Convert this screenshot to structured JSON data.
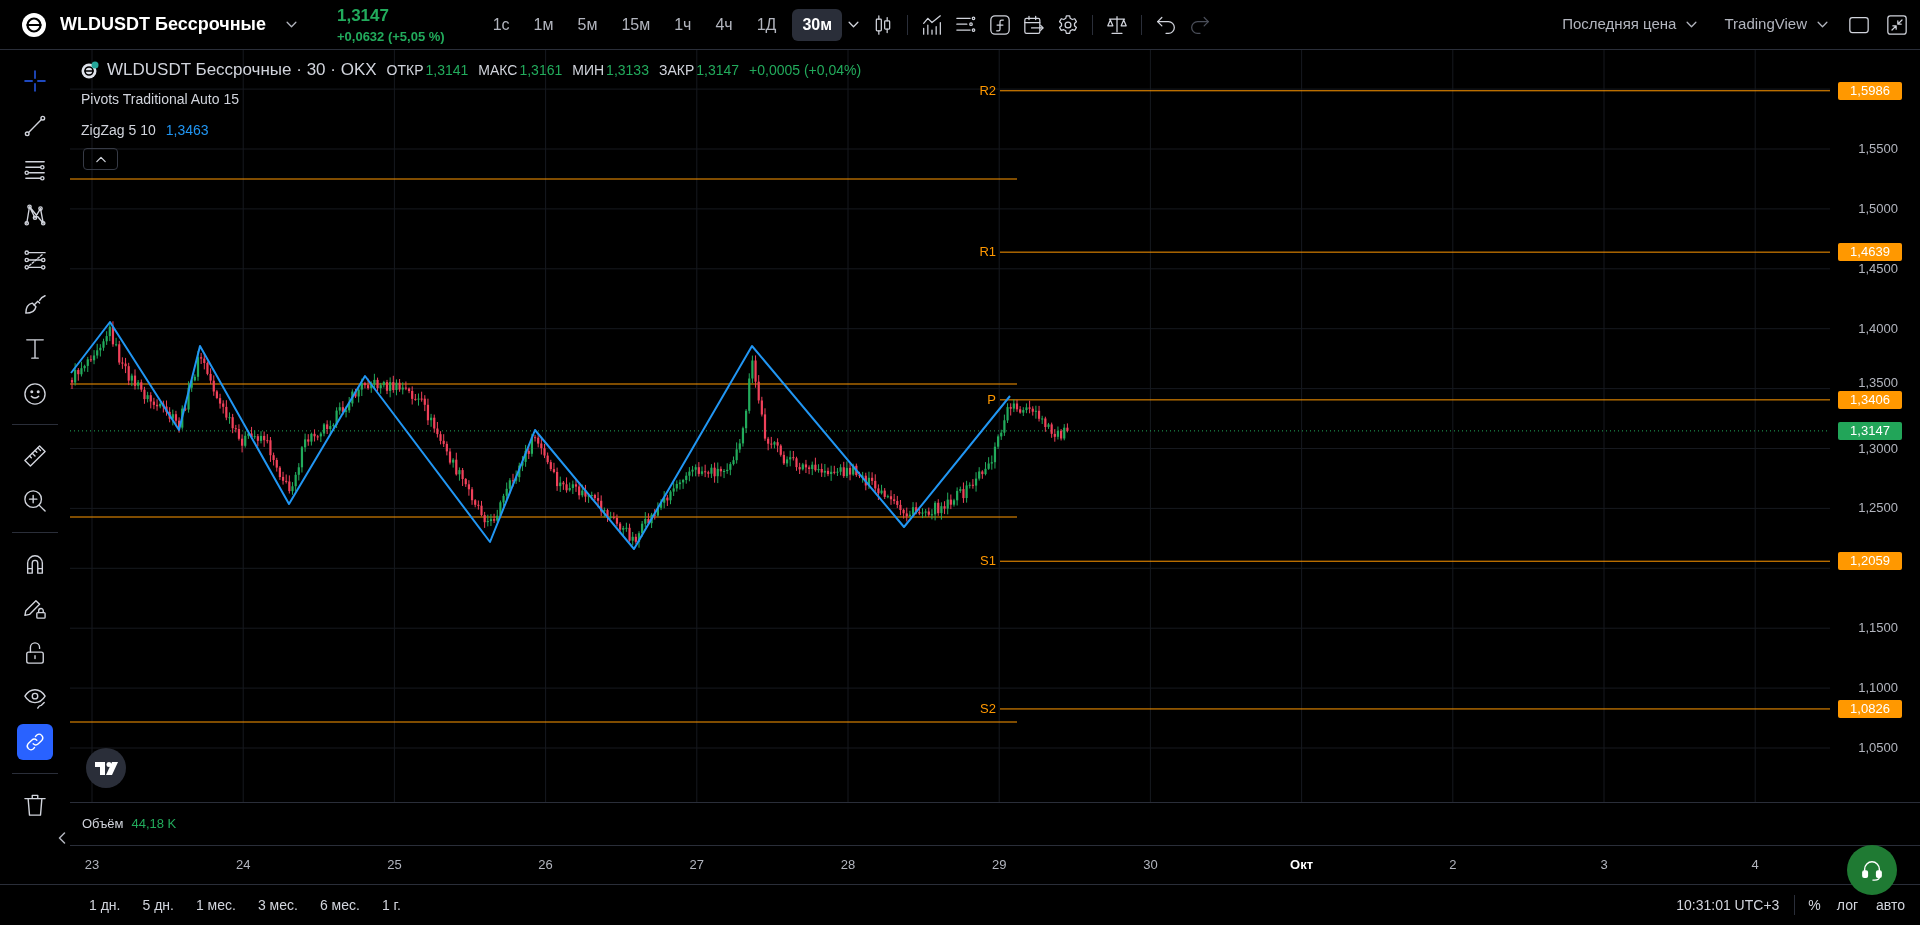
{
  "top_bar": {
    "symbol": "WLDUSDT Бессрочные",
    "price": "1,3147",
    "change": "+0,0632 (+5,05 %)",
    "intervals": [
      {
        "label": "1с",
        "selected": false
      },
      {
        "label": "1м",
        "selected": false
      },
      {
        "label": "5м",
        "selected": false
      },
      {
        "label": "15м",
        "selected": false
      },
      {
        "label": "1ч",
        "selected": false
      },
      {
        "label": "4ч",
        "selected": false
      },
      {
        "label": "1Д",
        "selected": false
      },
      {
        "label": "30м",
        "selected": true
      }
    ],
    "history": [
      {
        "disabled": false
      },
      {
        "disabled": true
      }
    ],
    "price_source": "Последняя цена",
    "layout": "TradingView"
  },
  "left_toolbar": {
    "tools": [
      {
        "selected": true
      },
      {
        "selected": false
      },
      {
        "selected": false
      },
      {
        "selected": false
      },
      {
        "selected": false
      },
      {
        "selected": false
      },
      {
        "selected": false
      },
      {
        "selected": false
      },
      {
        "selected": false
      },
      {
        "selected": false
      }
    ],
    "toggles": [
      {
        "on": false
      },
      {
        "on": false
      },
      {
        "on": false
      },
      {
        "on": false
      },
      {
        "on": true
      }
    ]
  },
  "legend": {
    "title": "WLDUSDT Бессрочные · 30 · OKX",
    "ohlc": [
      {
        "label": "ОТКР",
        "value": "1,3141"
      },
      {
        "label": "МАКС",
        "value": "1,3161"
      },
      {
        "label": "МИН",
        "value": "1,3133"
      },
      {
        "label": "ЗАКР",
        "value": "1,3147"
      }
    ],
    "change": "+0,0005 (+0,04%)",
    "indicators": [
      {
        "name": "Pivots Traditional Auto 15"
      },
      {
        "name": "ZigZag 5 10",
        "value": "1,3463"
      }
    ]
  },
  "chart": {
    "pivot_levels": [
      {
        "label": "R2",
        "value": "1,5986"
      },
      {
        "label": "R1",
        "value": "1,4639"
      },
      {
        "label": "P",
        "value": "1,3406"
      },
      {
        "label": "S1",
        "value": "1,2059"
      },
      {
        "label": "S2",
        "value": "1,0826"
      }
    ],
    "last_price": "1,3147"
  },
  "price_axis": {
    "labels": [
      "1,5500",
      "1,5000",
      "1,4500",
      "1,4000",
      "1,3500",
      "1,3000",
      "1,2500",
      "1,1500",
      "1,1000",
      "1,0500"
    ]
  },
  "volume": {
    "label": "Объём",
    "value": "44,18 K"
  },
  "time_axis": {
    "labels": [
      {
        "text": "23",
        "kind": "day"
      },
      {
        "text": "24",
        "kind": "day"
      },
      {
        "text": "25",
        "kind": "day"
      },
      {
        "text": "26",
        "kind": "day"
      },
      {
        "text": "27",
        "kind": "day"
      },
      {
        "text": "28",
        "kind": "day"
      },
      {
        "text": "29",
        "kind": "day"
      },
      {
        "text": "30",
        "kind": "day"
      },
      {
        "text": "Окт",
        "kind": "month"
      },
      {
        "text": "2",
        "kind": "day"
      },
      {
        "text": "3",
        "kind": "day"
      },
      {
        "text": "4",
        "kind": "day"
      }
    ]
  },
  "bottom_bar": {
    "ranges": [
      "1 дн.",
      "5 дн.",
      "1 мес.",
      "3 мес.",
      "6 мес.",
      "1 г."
    ],
    "clock": "10:31:01 UTC+3",
    "scale_options": [
      "%",
      "лог",
      "авто"
    ]
  }
}
